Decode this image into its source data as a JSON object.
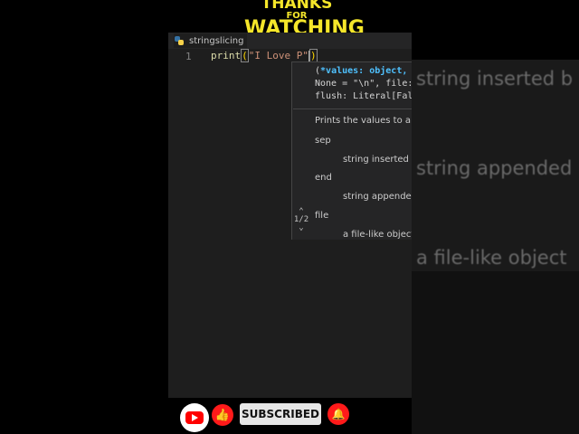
{
  "banner": {
    "line1": "THANKS",
    "line2": "FOR",
    "line3": "WATCHING"
  },
  "editor": {
    "tab_label": "stringslicing",
    "line_number": "1",
    "code": {
      "fn": "print",
      "open_paren": "(",
      "string": "\"I Love P\"",
      "close_paren": ")"
    }
  },
  "signature_help": {
    "line1_prefix": "(",
    "line1_param": "*values: object,",
    "line2": "None = \"\\n\", file:",
    "line3": "flush: Literal[Fal",
    "description": "Prints the values to a s",
    "sep_label": "sep",
    "sep_desc": "string inserted b",
    "end_label": "end",
    "end_desc": "string appended",
    "file_label": "file",
    "file_desc": "a file-like object",
    "overload": "1/2"
  },
  "right_overlay": {
    "text1": "string inserted b",
    "text2": "string appended",
    "text3": "a file-like object"
  },
  "bottom_bar": {
    "subscribe_label": "SUBSCRIBED"
  },
  "colors": {
    "accent_yellow": "#f5e62a",
    "youtube_red": "#ff0000",
    "editor_bg": "#1e1e1e"
  },
  "icons": [
    "python-icon",
    "youtube-icon",
    "thumbs-up-icon",
    "bell-icon",
    "chevron-up-icon",
    "chevron-down-icon"
  ]
}
